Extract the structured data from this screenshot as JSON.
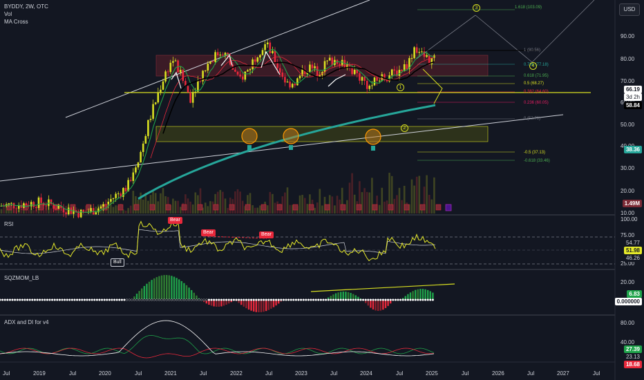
{
  "header": {
    "symbol_line": "BYDDY, 2W, OTC",
    "indicator_vol": "Vol",
    "indicator_ma": "MA Cross",
    "currency_button": "USD"
  },
  "panes": {
    "rsi_title": "RSI",
    "sqz_title": "SQZMOM_LB",
    "adx_title": "ADX and DI for v4"
  },
  "colors": {
    "background": "#131722",
    "candle_up": "#d9e021",
    "candle_down": "#e8283b",
    "ma_fast": "#1fa34a",
    "ma_slow": "#000000",
    "ma_long": "#26a69a",
    "rsi_line": "#e6ea2a",
    "fib_line": "#d9e021"
  },
  "price_axis": {
    "ticks": [
      "90.00",
      "80.00",
      "70.00",
      "60.00",
      "50.00",
      "40.00",
      "30.00",
      "20.00",
      "10.00"
    ]
  },
  "price_badges": {
    "last": "66.19",
    "countdown": "3d 2h",
    "ma": "58.84",
    "long_ma": "38.36",
    "volume": "1.49M"
  },
  "fib_labels": [
    "1.618 (103.09)",
    "0.786 (77.18)",
    "0.618 (71.95)",
    "0.5 (68.27)",
    "0.382 (64.60)",
    "0.236 (60.05)",
    "0 (52.70)",
    "-0.5 (37.13)",
    "-0.618 (33.46)",
    "1 (80.56)"
  ],
  "wave_labels": [
    "1",
    "2",
    "3",
    "4"
  ],
  "rsi": {
    "ticks": [
      "100.00",
      "75.00",
      "25.00"
    ],
    "values": [
      "54.77",
      "51.98",
      "46.26"
    ],
    "signals": [
      "Bear",
      "Bear",
      "Bear",
      "Bull"
    ]
  },
  "sqzmom": {
    "ticks": [
      "20.00"
    ],
    "values": [
      "6.83",
      "0.000000"
    ]
  },
  "adx": {
    "ticks": [
      "80.00",
      "40.00"
    ],
    "values": [
      "27.39",
      "23.13",
      "18.68"
    ]
  },
  "time_axis": [
    "Jul",
    "2019",
    "Jul",
    "2020",
    "Jul",
    "2021",
    "Jul",
    "2022",
    "Jul",
    "2023",
    "Jul",
    "2024",
    "Jul",
    "2025",
    "Jul",
    "2026",
    "Jul",
    "2027",
    "Jul"
  ],
  "chart_data": {
    "type": "candlestick",
    "title": "BYDDY, 2W, OTC",
    "ylim": [
      10,
      100
    ],
    "x": [
      "2018-07",
      "2019-01",
      "2019-07",
      "2020-01",
      "2020-07",
      "2021-01",
      "2021-07",
      "2022-01",
      "2022-07",
      "2023-01",
      "2023-07",
      "2024-01",
      "2024-07",
      "2025-01"
    ],
    "close_approx": [
      11,
      11,
      10,
      11,
      18,
      60,
      65,
      72,
      75,
      62,
      66,
      54,
      57,
      66.19
    ],
    "ma_cross": {
      "fast_last": 66.19,
      "slow_last": 58.84
    },
    "long_ma_last": 38.36,
    "volume_last": "1.49M",
    "rsi_last": [
      54.77,
      51.98,
      46.26
    ],
    "sqzmom_last": 6.83,
    "adx_last": [
      27.39,
      23.13,
      18.68
    ]
  }
}
